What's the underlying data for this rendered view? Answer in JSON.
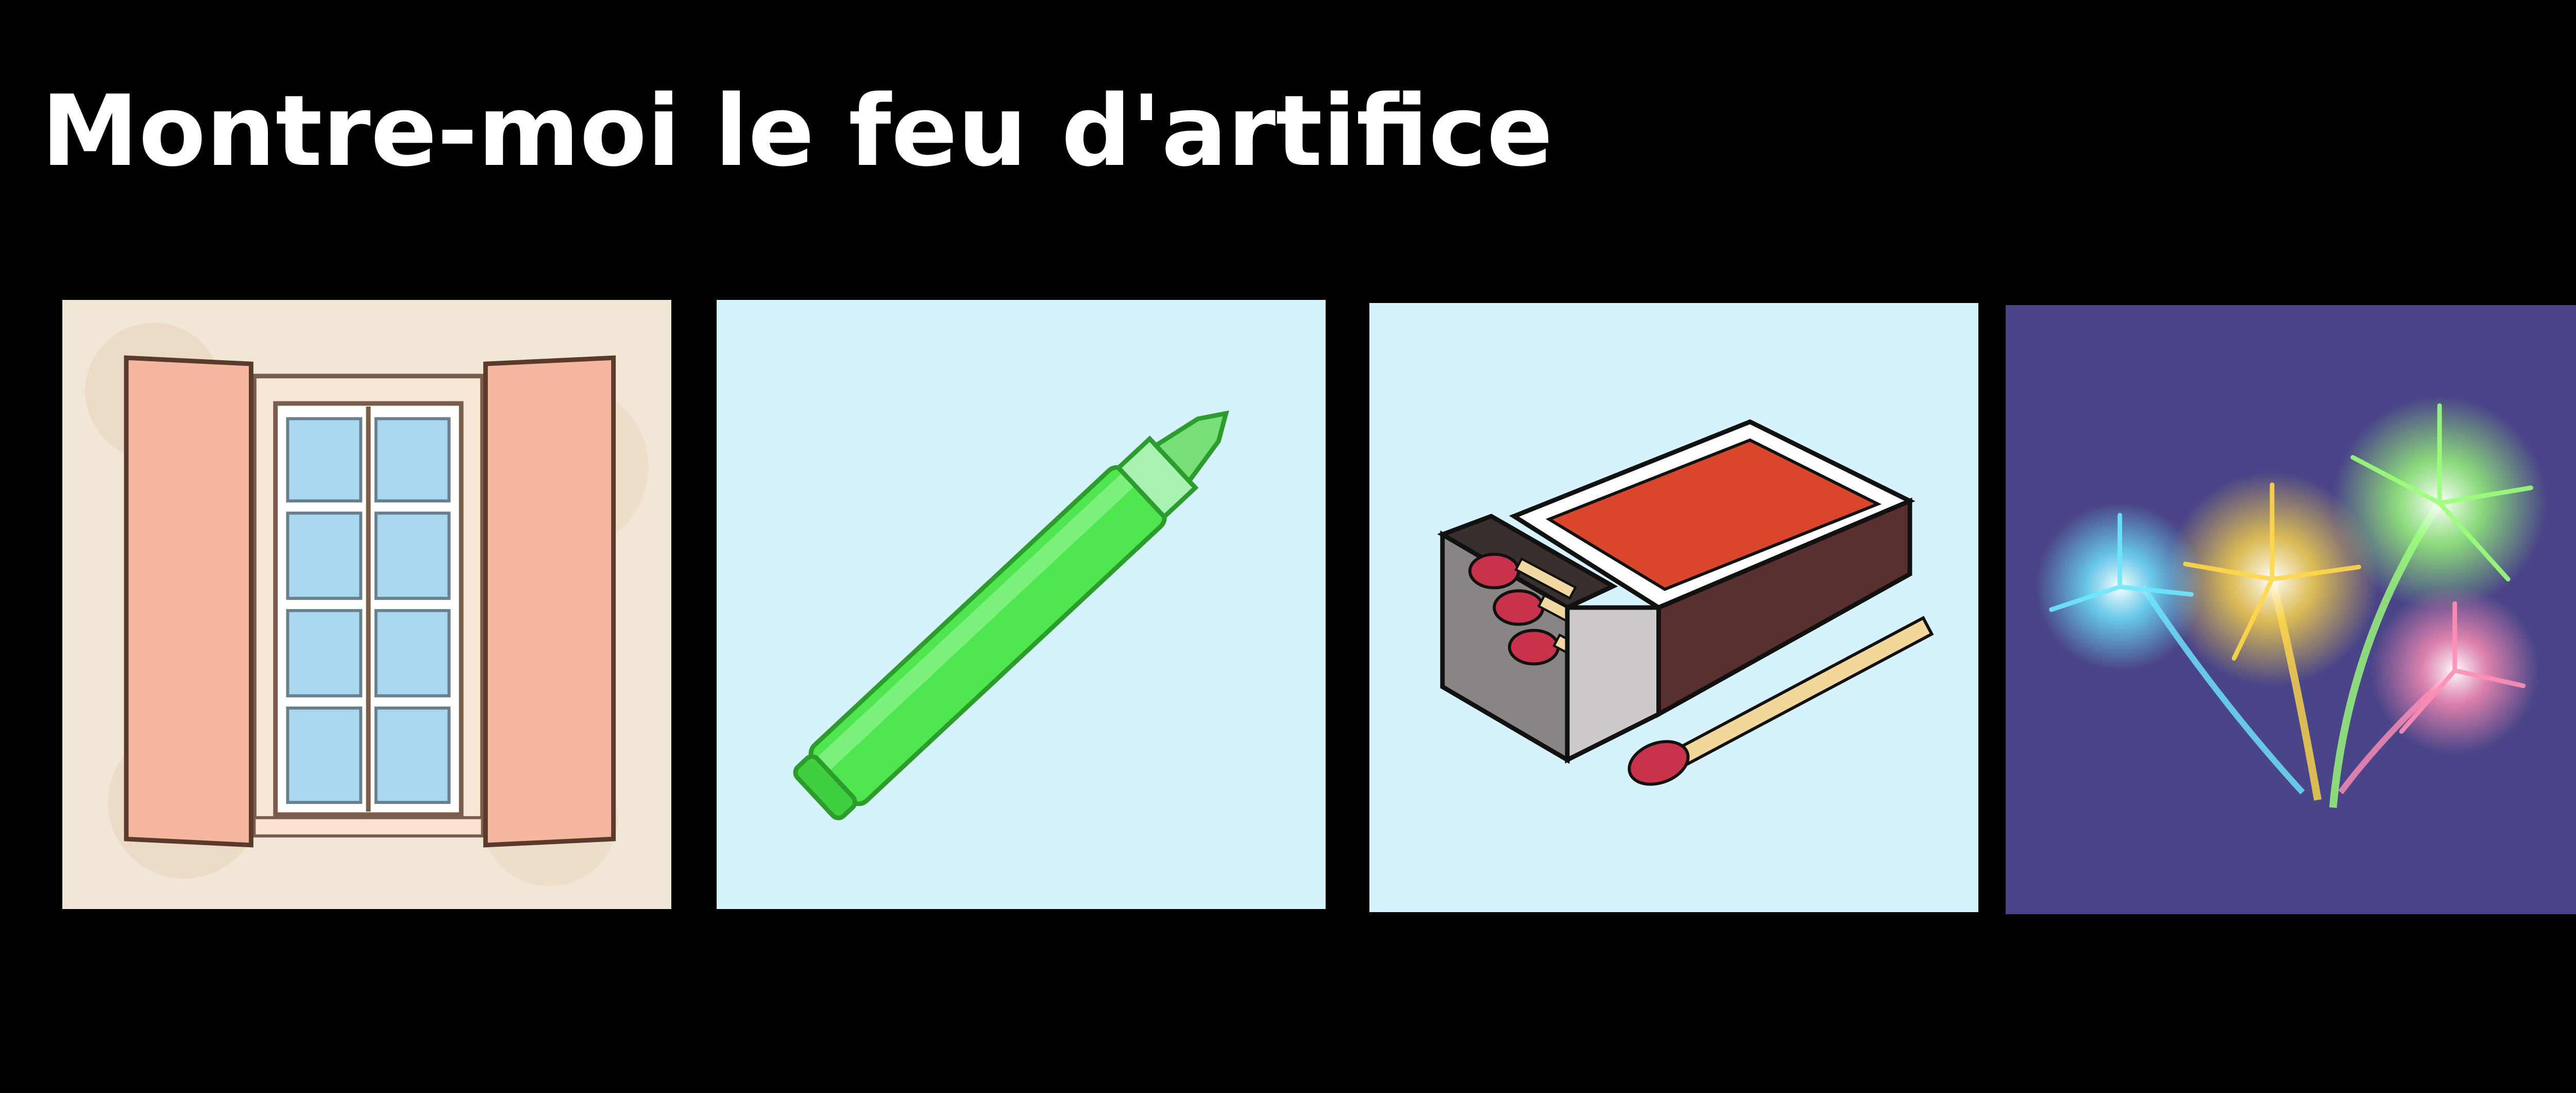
{
  "title": "Montre-moi le feu d'artifice",
  "cards": [
    {
      "icon": "window-icon",
      "background": "#f2e6d6",
      "accent": "#f5b7a0"
    },
    {
      "icon": "marker-icon",
      "background": "#d6f3fd",
      "accent": "#4fe64f"
    },
    {
      "icon": "matchbox-icon",
      "background": "#d6f3fd",
      "accent": "#d9462c"
    },
    {
      "icon": "fireworks-icon",
      "background": "#4a4588",
      "accent": "#9cff7a"
    }
  ]
}
